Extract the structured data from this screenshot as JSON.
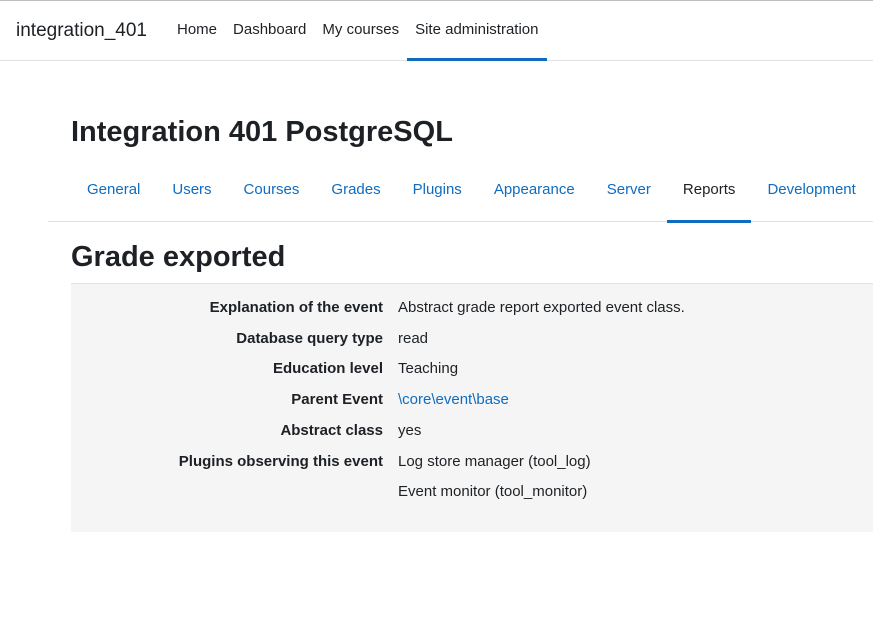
{
  "header": {
    "site_name": "integration_401",
    "nav": [
      {
        "label": "Home"
      },
      {
        "label": "Dashboard"
      },
      {
        "label": "My courses"
      },
      {
        "label": "Site administration",
        "active": true
      }
    ]
  },
  "page": {
    "title": "Integration 401 PostgreSQL"
  },
  "secondary_nav": {
    "tabs": [
      {
        "label": "General"
      },
      {
        "label": "Users"
      },
      {
        "label": "Courses"
      },
      {
        "label": "Grades"
      },
      {
        "label": "Plugins"
      },
      {
        "label": "Appearance"
      },
      {
        "label": "Server"
      },
      {
        "label": "Reports",
        "active": true
      },
      {
        "label": "Development"
      }
    ]
  },
  "event": {
    "heading": "Grade exported",
    "details": [
      {
        "label": "Explanation of the event",
        "value": "Abstract grade report exported event class."
      },
      {
        "label": "Database query type",
        "value": "read"
      },
      {
        "label": "Education level",
        "value": "Teaching"
      },
      {
        "label": "Parent Event",
        "value": "\\core\\event\\base"
      },
      {
        "label": "Abstract class",
        "value": "yes"
      },
      {
        "label": "Plugins observing this event",
        "value": "Log store manager (tool_log)"
      },
      {
        "label": "",
        "value": "Event monitor (tool_monitor)"
      }
    ]
  },
  "colors": {
    "link": "#0f6cbf",
    "text": "#1d2125",
    "detail_background": "#f5f5f5"
  }
}
